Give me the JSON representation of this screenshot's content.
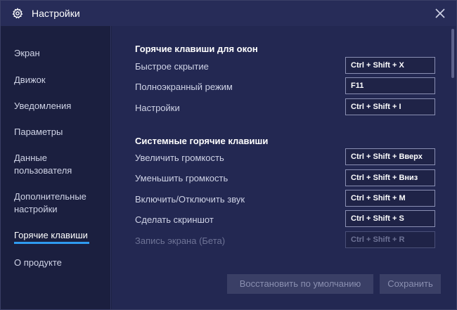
{
  "window": {
    "title": "Настройки"
  },
  "sidebar": {
    "items": [
      {
        "label": "Экран"
      },
      {
        "label": "Движок"
      },
      {
        "label": "Уведомления"
      },
      {
        "label": "Параметры"
      },
      {
        "label_line1": "Данные",
        "label_line2": "пользователя"
      },
      {
        "label_line1": "Дополнительные",
        "label_line2": "настройки"
      },
      {
        "label": "Горячие клавиши",
        "active": true
      },
      {
        "label": "О продукте"
      }
    ]
  },
  "window_hotkeys": {
    "title": "Горячие клавиши для окон",
    "rows": [
      {
        "label": "Быстрое скрытие",
        "value": "Ctrl + Shift + X"
      },
      {
        "label": "Полноэкранный режим",
        "value": "F11"
      },
      {
        "label": "Настройки",
        "value": "Ctrl + Shift + I"
      }
    ]
  },
  "system_hotkeys": {
    "title": "Системные горячие клавиши",
    "rows": [
      {
        "label": "Увеличить громкость",
        "value": "Ctrl + Shift + Вверх"
      },
      {
        "label": "Уменьшить громкость",
        "value": "Ctrl + Shift + Вниз"
      },
      {
        "label": "Включить/Отключить звук",
        "value": "Ctrl + Shift + M"
      },
      {
        "label": "Сделать скриншот",
        "value": "Ctrl + Shift + S"
      },
      {
        "label": "Запись экрана (Бета)",
        "value": "Ctrl + Shift + R",
        "disabled": true
      }
    ]
  },
  "buttons": {
    "restore": "Восстановить по умолчанию",
    "save": "Сохранить"
  },
  "colors": {
    "accent": "#2f9bf0",
    "titlebar": "#272c58",
    "content_bg": "#232852",
    "sidebar_bg": "#1b1f3f"
  }
}
